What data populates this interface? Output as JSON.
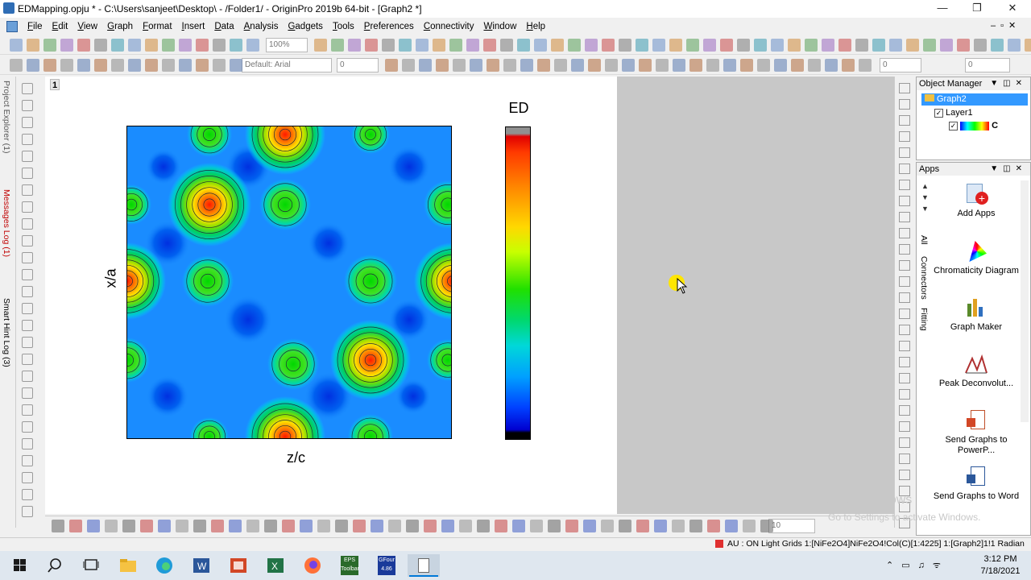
{
  "window": {
    "title": "EDMapping.opju * - C:\\Users\\sanjeet\\Desktop\\ - /Folder1/ - OriginPro 2019b 64-bit - [Graph2 *]"
  },
  "menu": [
    "File",
    "Edit",
    "View",
    "Graph",
    "Format",
    "Insert",
    "Data",
    "Analysis",
    "Gadgets",
    "Tools",
    "Preferences",
    "Connectivity",
    "Window",
    "Help"
  ],
  "toolbar": {
    "zoom": "100%",
    "font": "Default: Arial",
    "fontsize": "0",
    "linewidth": "0",
    "pattern": "0"
  },
  "sidebar": {
    "project_explorer": "Project Explorer (1)",
    "messages_log": "Messages Log (1)",
    "smart_hint": "Smart Hint Log (3)"
  },
  "graph": {
    "page": "1",
    "xlabel": "z/c",
    "ylabel": "x/a",
    "colorbar_title": "ED"
  },
  "object_manager": {
    "title": "Object Manager",
    "root": "Graph2",
    "layer": "Layer1",
    "plot": "C"
  },
  "apps": {
    "title": "Apps",
    "items": [
      "Add Apps",
      "Chromaticity Diagram",
      "Graph Maker",
      "Peak Deconvolut...",
      "Send Graphs to PowerP...",
      "Send Graphs to Word"
    ],
    "vtabs": [
      "All",
      "Connectors",
      "Fitting"
    ]
  },
  "bottombar": {
    "value": "10"
  },
  "status": {
    "text": "AU : ON  Light Grids  1:[NiFe2O4]NiFe2O4!Col(C)[1:4225]  1:[Graph2]1!1  Radian"
  },
  "watermark": {
    "line1": "Activate Windows",
    "line2": "Go to Settings to activate Windows."
  },
  "taskbar": {
    "time": "3:12 PM",
    "date": "7/18/2021",
    "gfour": "GFour 4.86",
    "eps": "EPS Toolbar"
  },
  "colors": {
    "accent": "#0078d7",
    "plot_bg": "#1a8cff"
  }
}
